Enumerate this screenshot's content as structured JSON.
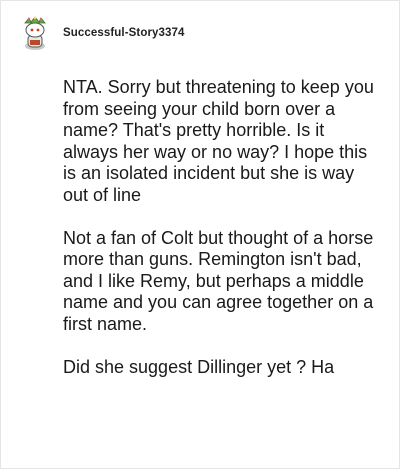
{
  "comment": {
    "username": "Successful-Story3374",
    "avatar_icon": "snoo-avatar-icon",
    "paragraphs": [
      "NTA. Sorry but threatening to keep you from seeing your child born over a name? That's pretty horrible. Is it always her way or no way? I hope this is an isolated incident but she is way out of line",
      "Not a fan of Colt but thought of a horse more than guns. Remington isn't bad, and I like Remy, but perhaps a middle name and you can agree together on a first name.",
      "Did she suggest Dillinger yet ? Ha"
    ]
  }
}
